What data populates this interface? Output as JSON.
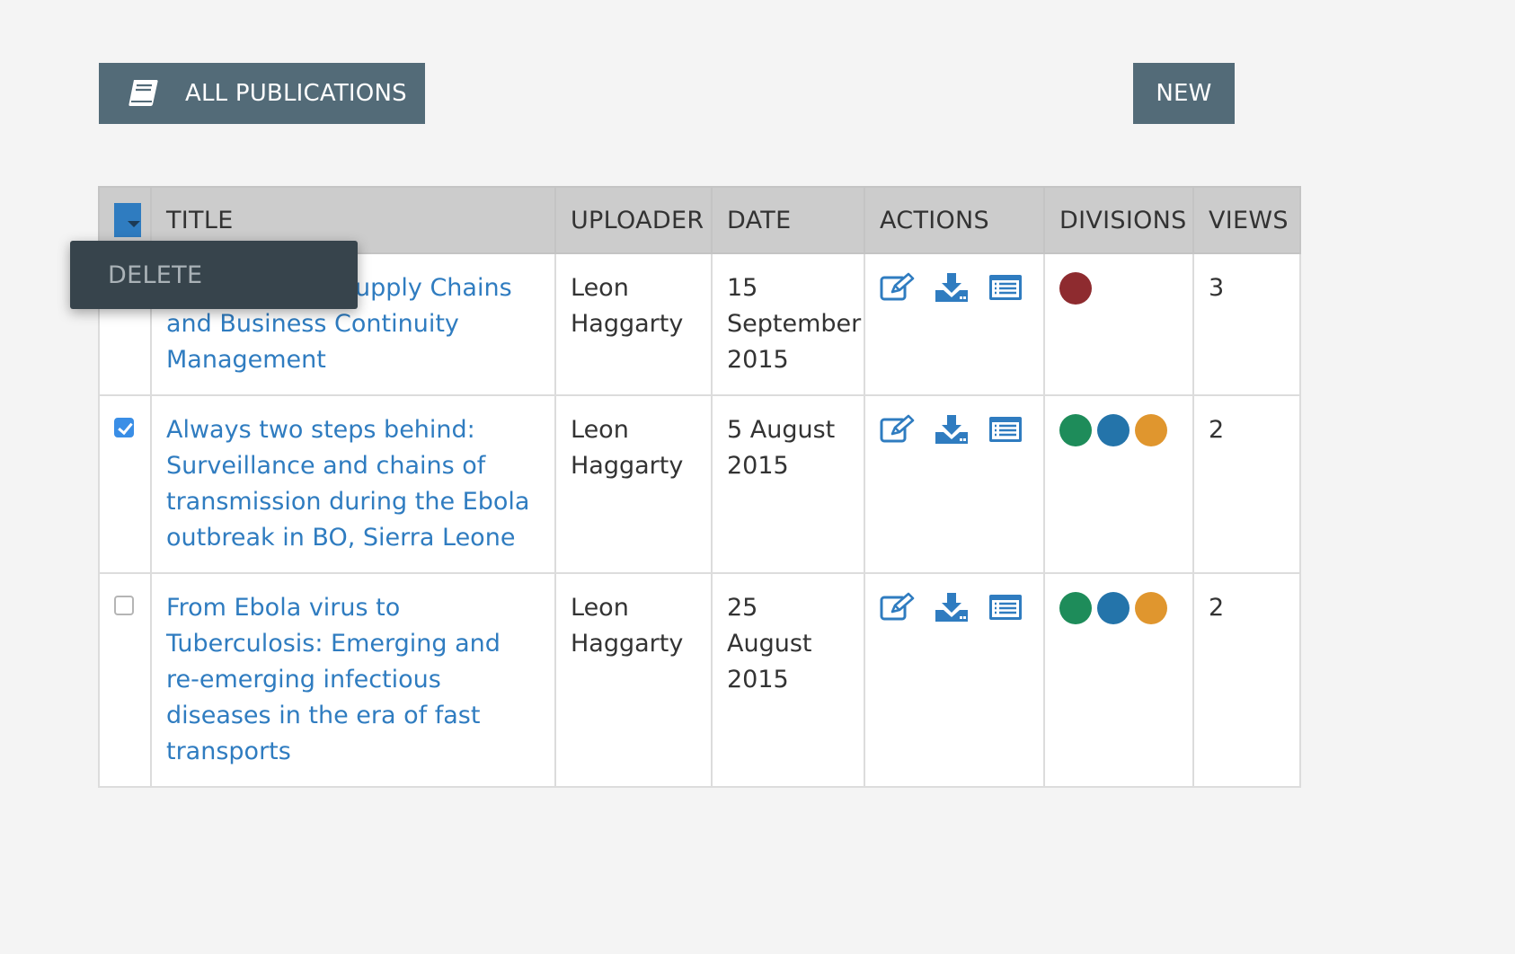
{
  "toolbar": {
    "all_publications_label": "ALL PUBLICATIONS",
    "new_label": "NEW"
  },
  "bulk_menu": {
    "delete_label": "DELETE"
  },
  "table": {
    "columns": [
      "TITLE",
      "UPLOADER",
      "DATE",
      "ACTIONS",
      "DIVISIONS",
      "VIEWS"
    ],
    "rows": [
      {
        "title": "Humanitarian Supply Chains and Business Continuity Management",
        "uploader": "Leon Haggarty",
        "date": "15 September 2015",
        "views": "3",
        "checked": false,
        "divisions": [
          "#8e2b2f"
        ]
      },
      {
        "title": "Always two steps behind: Surveillance and chains of transmission during the Ebola outbreak in BO, Sierra Leone",
        "uploader": "Leon Haggarty",
        "date": "5 August 2015",
        "views": "2",
        "checked": true,
        "divisions": [
          "#1e8c5a",
          "#2474aa",
          "#e0962e"
        ]
      },
      {
        "title": "From Ebola virus to Tuberculosis: Emerging and re-emerging infectious diseases in the era of fast transports",
        "uploader": "Leon Haggarty",
        "date": "25 August 2015",
        "views": "2",
        "checked": false,
        "divisions": [
          "#1e8c5a",
          "#2474aa",
          "#e0962e"
        ]
      }
    ]
  },
  "icons": {
    "book": "book-icon",
    "edit": "edit-icon",
    "download": "download-icon",
    "details": "list-icon"
  },
  "colors": {
    "button_bg": "#536b78",
    "link": "#2f7cc0",
    "header_bg": "#cccccc",
    "menu_bg": "#37444c"
  }
}
